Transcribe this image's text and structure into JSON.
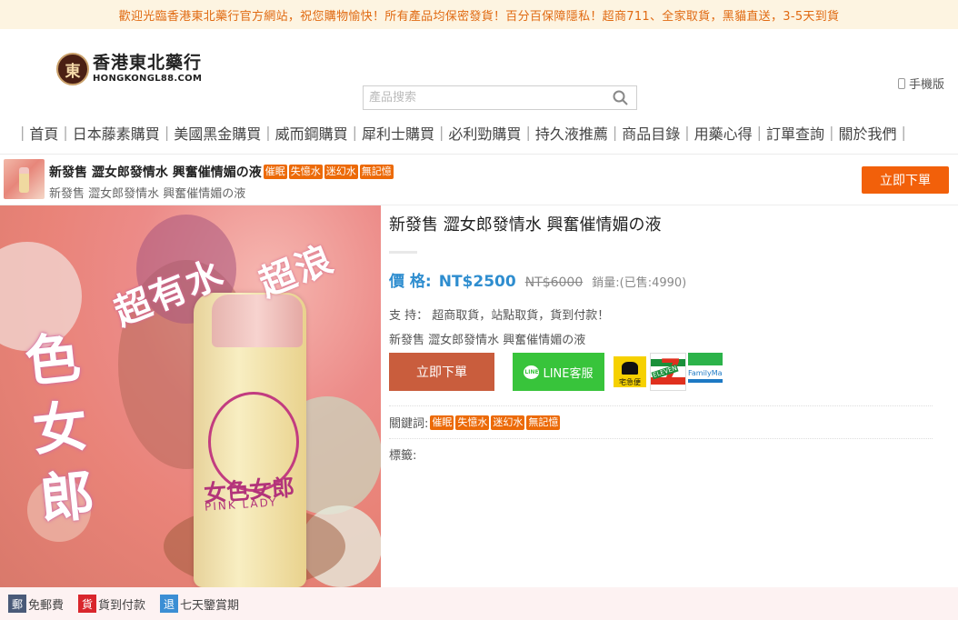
{
  "announcement": "歡迎光臨香港東北藥行官方網站，祝您購物愉快！所有產品均保密發貨！百分百保障隱私！超商711、全家取貨，黑貓直送，3-5天到貨",
  "logo": {
    "mark": "東",
    "name_cn": "香港東北藥行",
    "name_en": "HONGKONGL88.COM"
  },
  "search": {
    "placeholder": "產品搜索"
  },
  "mobile_label": "手機版",
  "nav": [
    "首頁",
    "日本藤素購買",
    "美國黑金購買",
    "威而鋼購買",
    "犀利士購買",
    "必利勁購買",
    "持久液推薦",
    "商品目錄",
    "用藥心得",
    "訂單查詢",
    "關於我們"
  ],
  "product_bar": {
    "title": "新發售 澀女郎發情水 興奮催情媚の液",
    "tags": [
      "催眠",
      "失憶水",
      "迷幻水",
      "無記憶"
    ],
    "subtitle": "新發售 澀女郎發情水 興奮催情媚の液",
    "order_label": "立即下單"
  },
  "image_text": {
    "phrase_a": "超有水",
    "phrase_b": "超浪",
    "vertical": "色女郎",
    "bottle_cn": "女色女郎",
    "bottle_en": "PINK LADY"
  },
  "product": {
    "title": "新發售 澀女郎發情水 興奮催情媚の液",
    "price_label": "價 格:",
    "price": "NT$2500",
    "old_price": "NT$6000",
    "sold": "銷量:(已售:4990)",
    "support": "支 持： 超商取貨，站點取貨，貨到付款！",
    "description": "新發售 澀女郎發情水 興奮催情媚の液",
    "order_label": "立即下單",
    "line_label": "LINE客服",
    "line_icon_text": "LINE",
    "shipping": {
      "kuroneko": "宅急便",
      "seven_num": "7",
      "seven_word": "ELEVEN",
      "family": "FamilyMar"
    },
    "keywords_label": "關鍵詞:",
    "keywords": [
      "催眠",
      "失憶水",
      "迷幻水",
      "無記憶"
    ],
    "labels_label": "標籤:"
  },
  "footer": [
    {
      "icon_text": "郵",
      "label": "免郵費",
      "color": "#4a5a78"
    },
    {
      "icon_text": "貨",
      "label": "貨到付款",
      "color": "#d9262c"
    },
    {
      "icon_text": "退",
      "label": "七天鑒賞期",
      "color": "#3b8ed4"
    }
  ],
  "colors": {
    "accent": "#f2600a",
    "price": "#2e8dcf",
    "line": "#38c43b",
    "announcement": "#e06a12"
  }
}
